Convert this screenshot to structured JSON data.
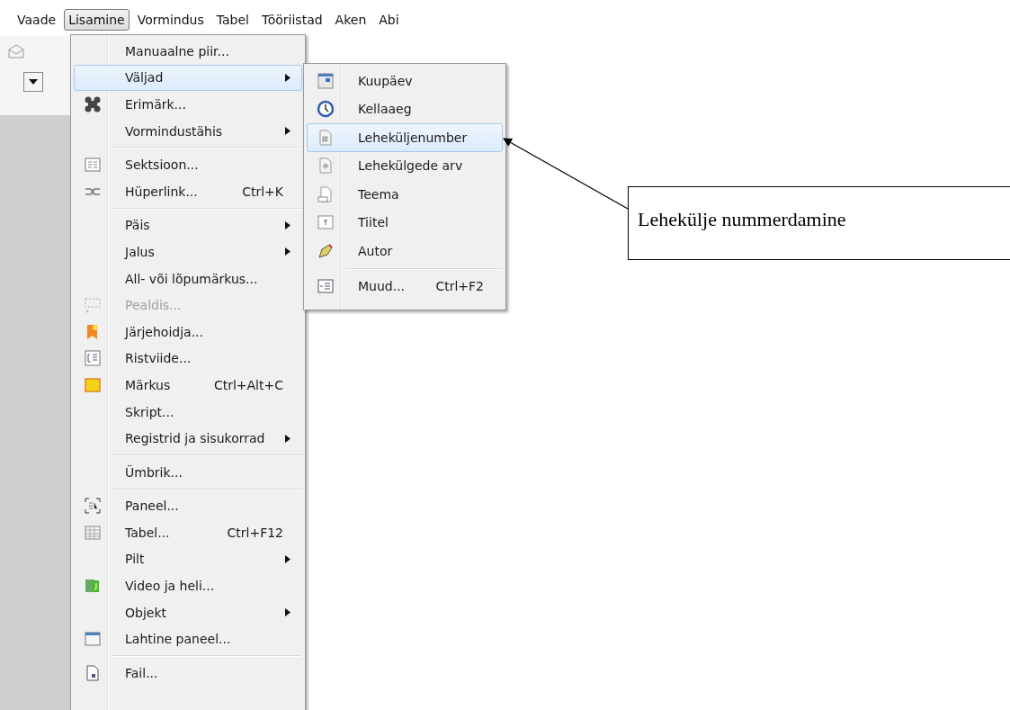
{
  "menubar": [
    {
      "label": "Vaade",
      "selected": false
    },
    {
      "label": "Lisamine",
      "selected": true
    },
    {
      "label": "Vormindus",
      "selected": false
    },
    {
      "label": "Tabel",
      "selected": false
    },
    {
      "label": "Tööriistad",
      "selected": false
    },
    {
      "label": "Aken",
      "selected": false
    },
    {
      "label": "Abi",
      "selected": false
    }
  ],
  "menu": [
    {
      "kind": "item",
      "label": "Manuaalne piir...",
      "selected": false,
      "disabled": false
    },
    {
      "kind": "submenu",
      "label": "Väljad",
      "selected": true,
      "disabled": false
    },
    {
      "kind": "item",
      "label": "Erimärk...",
      "selected": false,
      "disabled": false
    },
    {
      "kind": "submenu",
      "label": "Vormindustähis",
      "selected": false,
      "disabled": false
    },
    {
      "kind": "separator"
    },
    {
      "kind": "item",
      "label": "Sektsioon...",
      "selected": false,
      "disabled": false
    },
    {
      "kind": "item",
      "label": "Hüperlink...",
      "shortcut": "Ctrl+K",
      "selected": false,
      "disabled": false
    },
    {
      "kind": "separator"
    },
    {
      "kind": "submenu",
      "label": "Päis",
      "selected": false,
      "disabled": false
    },
    {
      "kind": "submenu",
      "label": "Jalus",
      "selected": false,
      "disabled": false
    },
    {
      "kind": "item",
      "label": "All- või lõpumärkus...",
      "selected": false,
      "disabled": false
    },
    {
      "kind": "item",
      "label": "Pealdis...",
      "selected": false,
      "disabled": true
    },
    {
      "kind": "item",
      "label": "Järjehoidja...",
      "selected": false,
      "disabled": false
    },
    {
      "kind": "item",
      "label": "Ristviide...",
      "selected": false,
      "disabled": false
    },
    {
      "kind": "item",
      "label": "Märkus",
      "shortcut": "Ctrl+Alt+C",
      "selected": false,
      "disabled": false
    },
    {
      "kind": "item",
      "label": "Skript...",
      "selected": false,
      "disabled": false
    },
    {
      "kind": "submenu",
      "label": "Registrid ja sisukorrad",
      "selected": false,
      "disabled": false
    },
    {
      "kind": "separator"
    },
    {
      "kind": "item",
      "label": "Ümbrik...",
      "selected": false,
      "disabled": false
    },
    {
      "kind": "separator"
    },
    {
      "kind": "item",
      "label": "Paneel...",
      "selected": false,
      "disabled": false
    },
    {
      "kind": "item",
      "label": "Tabel...",
      "shortcut": "Ctrl+F12",
      "selected": false,
      "disabled": false
    },
    {
      "kind": "submenu",
      "label": "Pilt",
      "selected": false,
      "disabled": false
    },
    {
      "kind": "item",
      "label": "Video ja heli...",
      "selected": false,
      "disabled": false
    },
    {
      "kind": "submenu",
      "label": "Objekt",
      "selected": false,
      "disabled": false
    },
    {
      "kind": "item",
      "label": "Lahtine paneel...",
      "selected": false,
      "disabled": false
    },
    {
      "kind": "separator"
    },
    {
      "kind": "item",
      "label": "Fail...",
      "selected": false,
      "disabled": false
    }
  ],
  "submenu": [
    {
      "kind": "item",
      "label": "Kuupäev",
      "selected": false
    },
    {
      "kind": "item",
      "label": "Kellaaeg",
      "selected": false
    },
    {
      "kind": "item",
      "label": "Leheküljenumber",
      "selected": true
    },
    {
      "kind": "item",
      "label": "Lehekülgede arv",
      "selected": false
    },
    {
      "kind": "item",
      "label": "Teema",
      "selected": false
    },
    {
      "kind": "item",
      "label": "Tiitel",
      "selected": false
    },
    {
      "kind": "item",
      "label": "Autor",
      "selected": false
    },
    {
      "kind": "separator"
    },
    {
      "kind": "item",
      "label": "Muud...",
      "shortcut": "Ctrl+F2",
      "selected": false
    }
  ],
  "callout": {
    "text": "Lehekülje nummerdamine"
  }
}
